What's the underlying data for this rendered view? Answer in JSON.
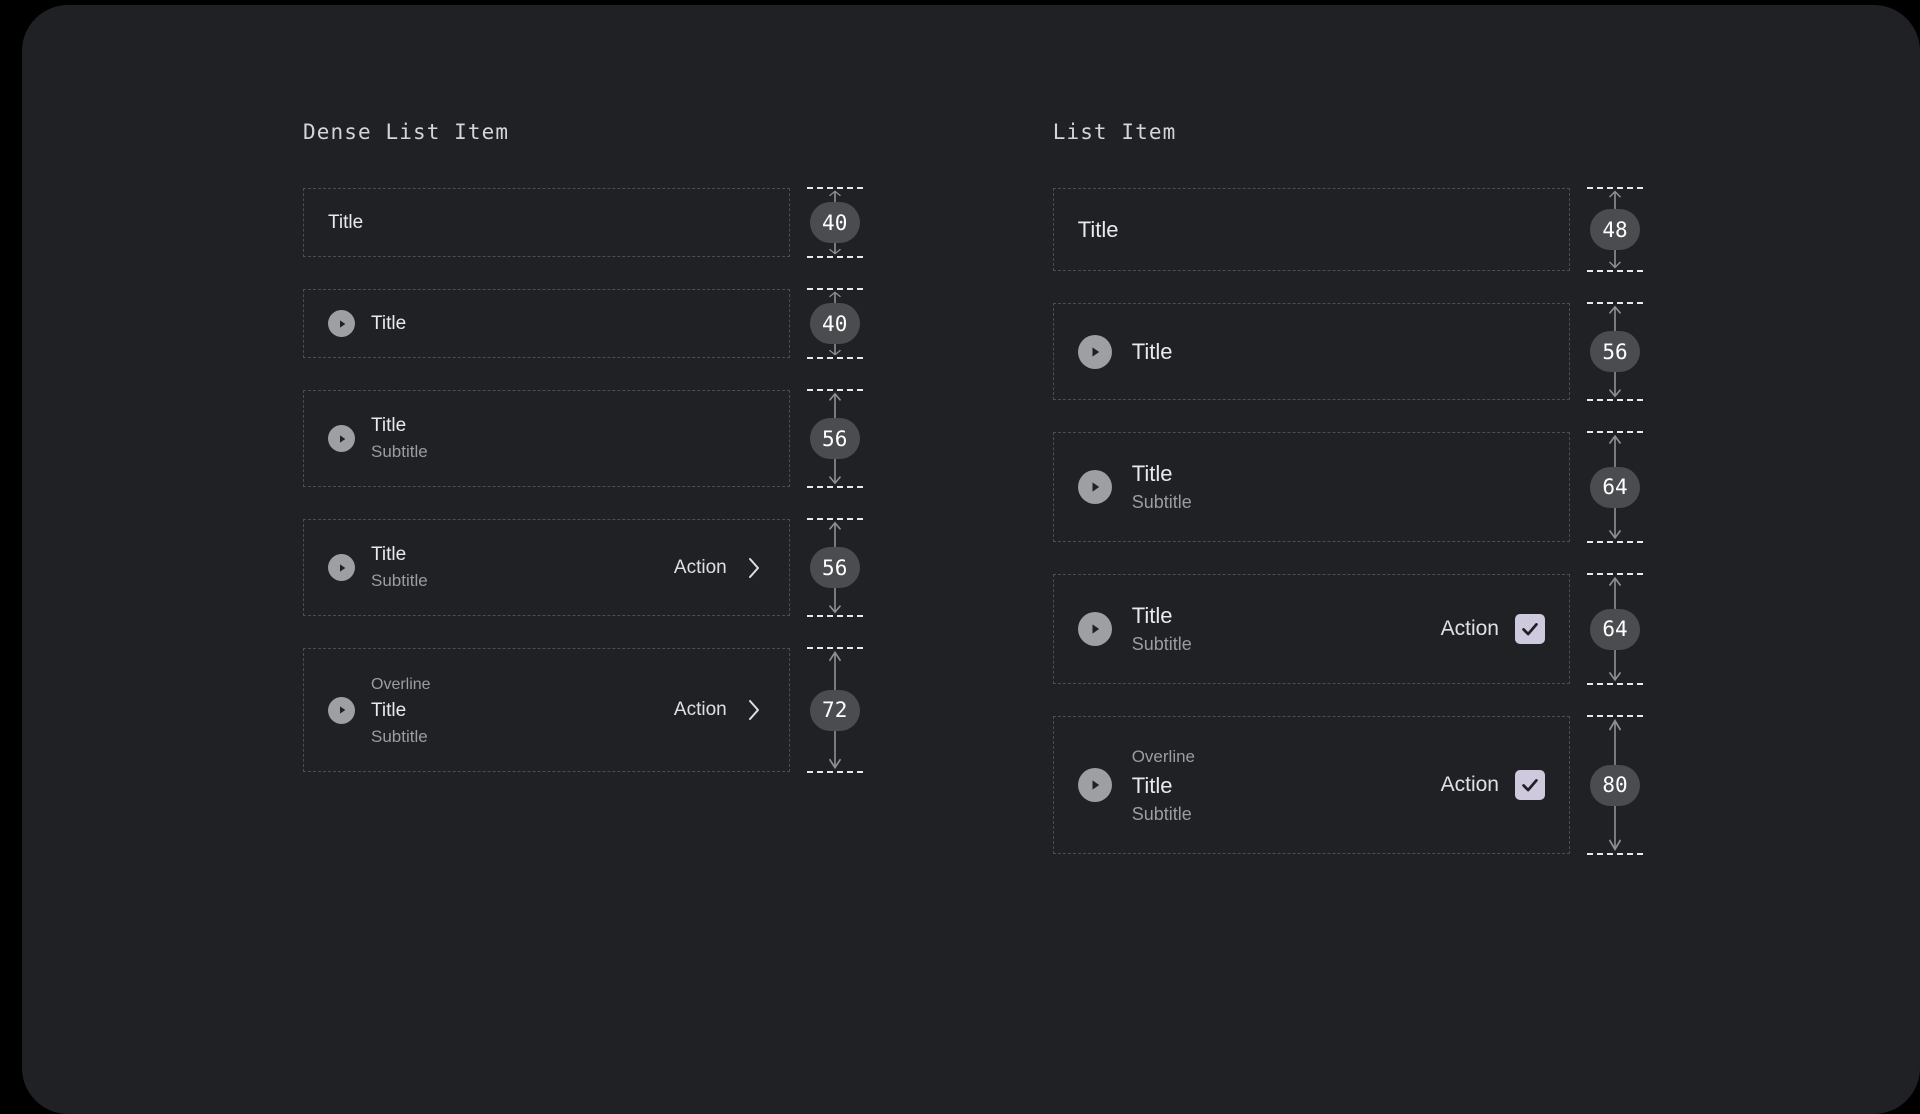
{
  "theme": {
    "page_bg": "#000000",
    "panel_bg": "#1f2124",
    "dash_border": "#4a4d51",
    "title_color": "#e9eaec",
    "secondary_color": "#9a9da1",
    "avatar_bg": "#9e9fa2",
    "badge_bg": "#4a4c4f",
    "badge_text": "#ffffff",
    "checkbox_bg": "#cfc9de",
    "checkbox_tick": "#1f2124",
    "measure_line": "#e8e9ea"
  },
  "columns": [
    {
      "heading": "Dense List Item",
      "density": "dense",
      "specs": [
        {
          "height": "40",
          "avatar": false,
          "overline": null,
          "title": "Title",
          "subtitle": null,
          "action_label": null,
          "trailing_icon": null
        },
        {
          "height": "40",
          "avatar": true,
          "avatar_icon": "play-circle-icon",
          "overline": null,
          "title": "Title",
          "subtitle": null,
          "action_label": null,
          "trailing_icon": null
        },
        {
          "height": "56",
          "avatar": true,
          "avatar_icon": "play-circle-icon",
          "overline": null,
          "title": "Title",
          "subtitle": "Subtitle",
          "action_label": null,
          "trailing_icon": null
        },
        {
          "height": "56",
          "avatar": true,
          "avatar_icon": "play-circle-icon",
          "overline": null,
          "title": "Title",
          "subtitle": "Subtitle",
          "action_label": "Action",
          "trailing_icon": "chevron-right-icon"
        },
        {
          "height": "72",
          "avatar": true,
          "avatar_icon": "play-circle-icon",
          "overline": "Overline",
          "title": "Title",
          "subtitle": "Subtitle",
          "action_label": "Action",
          "trailing_icon": "chevron-right-icon"
        }
      ]
    },
    {
      "heading": "List Item",
      "density": "regular",
      "specs": [
        {
          "height": "48",
          "avatar": false,
          "overline": null,
          "title": "Title",
          "subtitle": null,
          "action_label": null,
          "trailing_icon": null
        },
        {
          "height": "56",
          "avatar": true,
          "avatar_icon": "play-circle-icon",
          "overline": null,
          "title": "Title",
          "subtitle": null,
          "action_label": null,
          "trailing_icon": null
        },
        {
          "height": "64",
          "avatar": true,
          "avatar_icon": "play-circle-icon",
          "overline": null,
          "title": "Title",
          "subtitle": "Subtitle",
          "action_label": null,
          "trailing_icon": null
        },
        {
          "height": "64",
          "avatar": true,
          "avatar_icon": "play-circle-icon",
          "overline": null,
          "title": "Title",
          "subtitle": "Subtitle",
          "action_label": "Action",
          "trailing_icon": "checkbox-checked-icon"
        },
        {
          "height": "80",
          "avatar": true,
          "avatar_icon": "play-circle-icon",
          "overline": "Overline",
          "title": "Title",
          "subtitle": "Subtitle",
          "action_label": "Action",
          "trailing_icon": "checkbox-checked-icon"
        }
      ]
    }
  ]
}
